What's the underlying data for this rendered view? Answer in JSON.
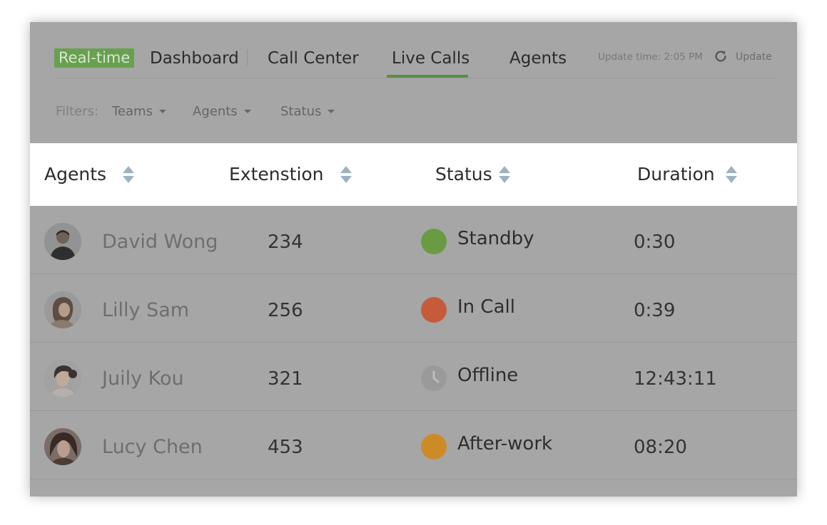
{
  "nav": {
    "badge": "Real-time",
    "dashboard": "Dashboard",
    "tabs": [
      "Call Center",
      "Live Calls",
      "Agents"
    ],
    "active_tab": "Live Calls",
    "update_time": "Update time: 2:05 PM",
    "update_label": "Update"
  },
  "filters": {
    "label": "Filters:",
    "items": [
      "Teams",
      "Agents",
      "Status"
    ]
  },
  "table": {
    "headers": [
      "Agents",
      "Extenstion",
      "Status",
      "Duration"
    ],
    "rows": [
      {
        "name": "David Wong",
        "ext": "234",
        "status": "Standby",
        "status_color": "#6a9b42",
        "duration": "0:30",
        "avatar_icon": "male-agent-avatar"
      },
      {
        "name": "Lilly Sam",
        "ext": "256",
        "status": "In Call",
        "status_color": "#c65b3b",
        "duration": "0:39",
        "avatar_icon": "female-agent-avatar"
      },
      {
        "name": "Juily Kou",
        "ext": "321",
        "status": "Offline",
        "status_color": "#9a9a9a",
        "duration": "12:43:11",
        "avatar_icon": "female-agent-avatar"
      },
      {
        "name": "Lucy Chen",
        "ext": "453",
        "status": "After-work",
        "status_color": "#cd8b27",
        "duration": "08:20",
        "avatar_icon": "female-agent-avatar"
      }
    ]
  },
  "colors": {
    "overlay_bg": "#a6a6a6",
    "badge_green": "#68a050",
    "tab_underline": "#5c8d48",
    "header_bg": "#ffffff"
  }
}
